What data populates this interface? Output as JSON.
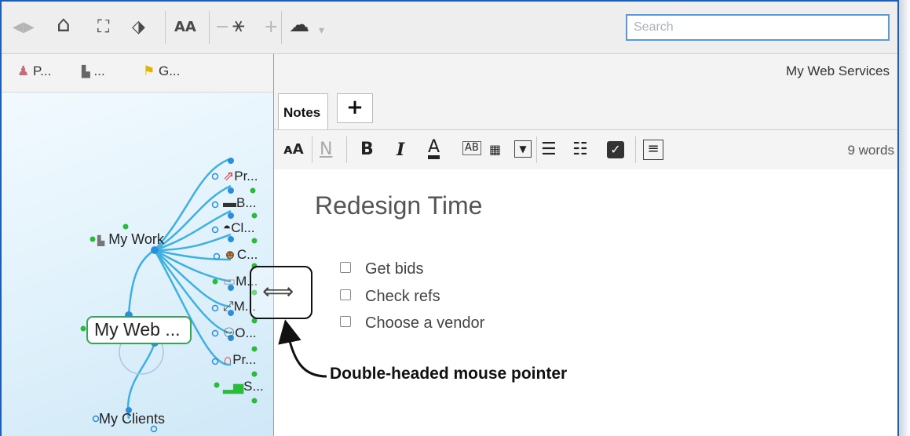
{
  "toolbar": {
    "buttons": [
      {
        "name": "back-forward-icon",
        "glyph": "◀▶"
      },
      {
        "name": "home-icon",
        "glyph": "⌂"
      },
      {
        "name": "map-filter-icon",
        "glyph": "⛶"
      },
      {
        "name": "tag-icon",
        "glyph": "⬗"
      },
      {
        "name": "font-size-icon",
        "glyph": "AA"
      },
      {
        "name": "collapse-minus-icon",
        "glyph": "−"
      },
      {
        "name": "map-layout-icon",
        "glyph": "⚹"
      },
      {
        "name": "expand-plus-icon",
        "glyph": "+"
      },
      {
        "name": "cloud-icon",
        "glyph": "☁"
      },
      {
        "name": "cloud-dropdown-icon",
        "glyph": "▾"
      }
    ],
    "search_placeholder": "Search"
  },
  "filters": [
    "P...",
    "...",
    "G..."
  ],
  "map": {
    "central": "My Web ...",
    "my_work": "My Work",
    "my_clients": "My Clients",
    "branches": [
      "Pr...",
      "B...",
      "Cl...",
      "C...",
      "M...",
      "M...",
      "O...",
      "Pr...",
      "S..."
    ]
  },
  "notes": {
    "topic_title": "My Web Services",
    "tab_label": "Notes",
    "add_tab": "+",
    "word_count": "9 words",
    "note_title": "Redesign Time",
    "tasks": [
      "Get bids",
      "Check refs",
      "Choose a vendor"
    ]
  },
  "annotation": {
    "caption": "Double-headed mouse pointer",
    "cursor_glyph": "⟺"
  },
  "colors": {
    "window_border": "#1f5fb3",
    "branch_line": "#3fb0e0",
    "node_dot_blue": "#2a8fd8",
    "node_dot_green": "#2bbb3a",
    "central_border": "#3aa35a",
    "search_border": "#5a9ad9"
  }
}
